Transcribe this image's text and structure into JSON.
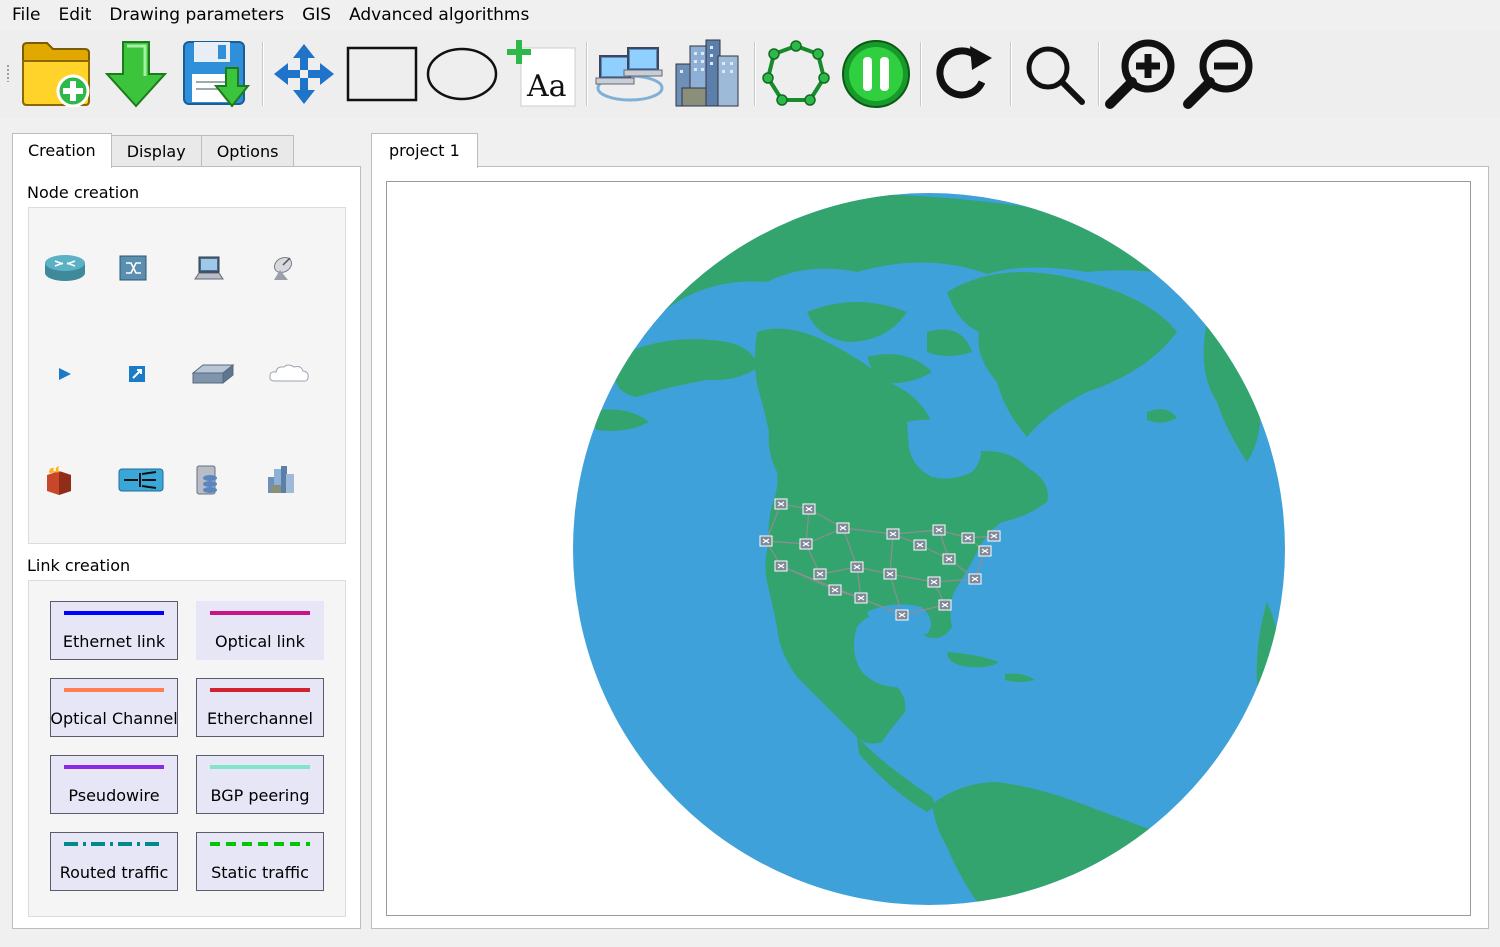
{
  "menu": [
    "File",
    "Edit",
    "Drawing parameters",
    "GIS",
    "Advanced algorithms"
  ],
  "toolbar": {
    "tools": [
      "new-project-icon",
      "import-icon",
      "save-icon",
      "move-icon",
      "rectangle-icon",
      "ellipse-icon",
      "add-text-icon",
      "network-icon",
      "city-icon",
      "graph-layout-icon",
      "pause-icon",
      "refresh-icon",
      "search-icon",
      "zoom-in-icon",
      "zoom-out-icon"
    ],
    "add_text_glyph": "Aa"
  },
  "left_tabs": [
    "Creation",
    "Display",
    "Options"
  ],
  "active_left_tab": "Creation",
  "node_creation": {
    "title": "Node creation",
    "icons": [
      "router-icon",
      "switch-icon",
      "host-icon",
      "antenna-icon",
      "regenerator-icon",
      "splitter-icon",
      "layer3-switch-icon",
      "cloud-icon",
      "firewall-icon",
      "load-balancer-icon",
      "server-icon",
      "site-icon"
    ]
  },
  "link_creation": {
    "title": "Link creation",
    "links": [
      {
        "label": "Ethernet link",
        "color": "#0000ff",
        "style": "solid"
      },
      {
        "label": "Optical link",
        "color": "#c71585",
        "style": "solid"
      },
      {
        "label": "Optical Channel",
        "color": "#ff7f50",
        "style": "solid"
      },
      {
        "label": "Etherchannel",
        "color": "#d2222d",
        "style": "solid"
      },
      {
        "label": "Pseudowire",
        "color": "#8a2be2",
        "style": "solid"
      },
      {
        "label": "BGP peering",
        "color": "#7fe6c8",
        "style": "solid"
      },
      {
        "label": "Routed traffic",
        "color": "#008b8b",
        "style": "dashdot"
      },
      {
        "label": "Static traffic",
        "color": "#00c800",
        "style": "dashed"
      }
    ]
  },
  "project_tab": "project 1",
  "map": {
    "ocean_color": "#3fa1d9",
    "land_color": "#34a46e",
    "node_count": 22,
    "link_color": "#8e8e8e"
  }
}
